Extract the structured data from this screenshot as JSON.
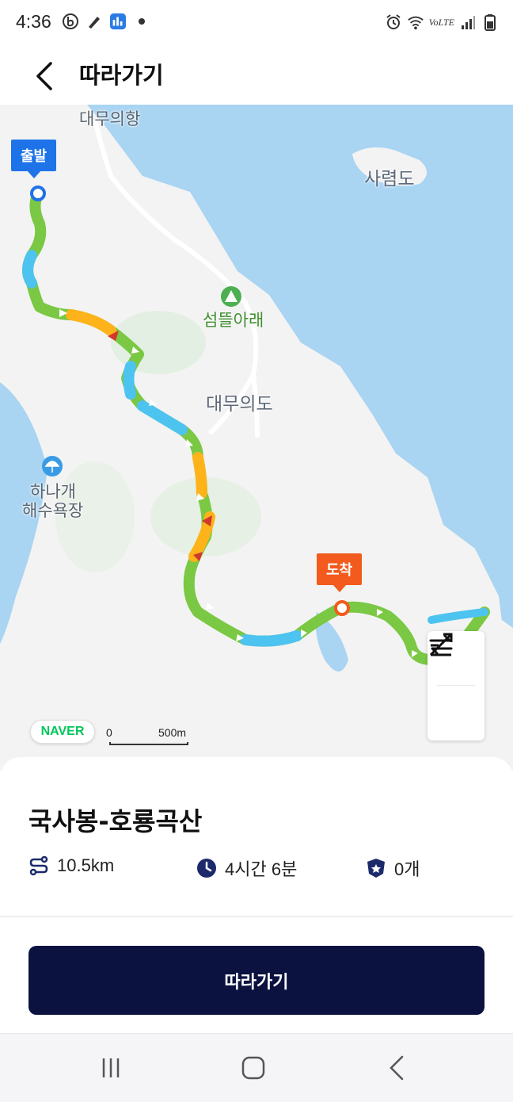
{
  "status_bar": {
    "time": "4:36",
    "left_icons": [
      "b-app-icon",
      "pen-icon",
      "app-icon",
      "dot-icon"
    ],
    "right_icons": [
      "alarm-icon",
      "wifi-icon",
      "volte-icon",
      "signal-icon",
      "battery-icon"
    ],
    "volte_text": "VoLTE"
  },
  "app_bar": {
    "back_icon": "chevron-left-icon",
    "title": "따라가기"
  },
  "map": {
    "labels": {
      "port": "대무의항",
      "island_ne": "사렴도",
      "camp": "섬뜰아래",
      "island_main": "대무의도",
      "beach_line1": "하나개",
      "beach_line2": "해수욕장"
    },
    "start_marker": "출발",
    "end_marker": "도착",
    "logo": "NAVER",
    "scale": {
      "zero": "0",
      "distance": "500m"
    },
    "controls": [
      "route-toggle-icon",
      "swap-direction-icon"
    ]
  },
  "course": {
    "name": "국사봉-호룡곡산",
    "distance": "10.5km",
    "duration": "4시간 6분",
    "stamps": "0개"
  },
  "action": {
    "follow_label": "따라가기"
  },
  "nav": [
    "recent-apps-icon",
    "home-icon",
    "back-icon"
  ]
}
